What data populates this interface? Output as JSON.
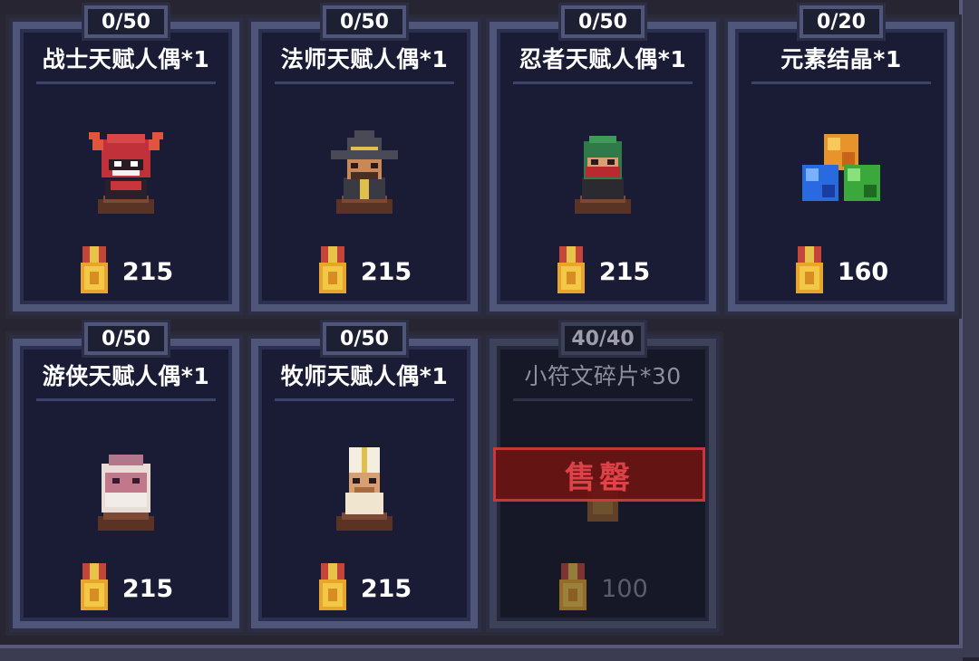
{
  "shop": {
    "items": [
      {
        "stock": "0/50",
        "title": "战士天赋人偶*1",
        "price": "215",
        "icon": "warrior-doll-icon"
      },
      {
        "stock": "0/50",
        "title": "法师天赋人偶*1",
        "price": "215",
        "icon": "mage-doll-icon"
      },
      {
        "stock": "0/50",
        "title": "忍者天赋人偶*1",
        "price": "215",
        "icon": "ninja-doll-icon"
      },
      {
        "stock": "0/20",
        "title": "元素结晶*1",
        "price": "160",
        "icon": "element-crystal-icon"
      },
      {
        "stock": "0/50",
        "title": "游侠天赋人偶*1",
        "price": "215",
        "icon": "ranger-doll-icon"
      },
      {
        "stock": "0/50",
        "title": "牧师天赋人偶*1",
        "price": "215",
        "icon": "priest-doll-icon"
      },
      {
        "stock": "40/40",
        "title": "小符文碎片*30",
        "price": "100",
        "icon": "rune-shard-icon",
        "status": "售罄"
      }
    ],
    "currency_icon": "medal-icon",
    "colors": {
      "card_bg": "#1a1c36",
      "card_border": "#4f5679",
      "soldout_red": "#e8454a"
    }
  }
}
